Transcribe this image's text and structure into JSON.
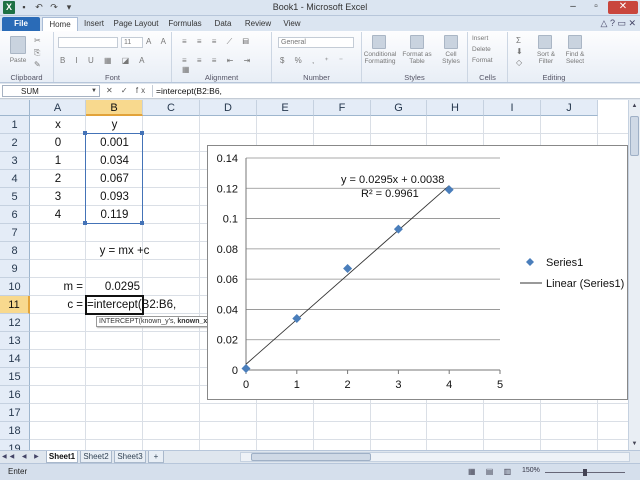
{
  "window": {
    "title": "Book1 - Microsoft Excel"
  },
  "tabs": [
    "File",
    "Home",
    "Insert",
    "Page Layout",
    "Formulas",
    "Data",
    "Review",
    "View"
  ],
  "ribbon": {
    "groups": [
      "Clipboard",
      "Font",
      "Alignment",
      "Number",
      "Styles",
      "Cells",
      "Editing"
    ],
    "paste_label": "Paste",
    "font_size": "11",
    "number_format": "General",
    "styles_buttons": [
      "Conditional Formatting",
      "Format as Table",
      "Cell Styles"
    ],
    "cells_buttons": [
      "Insert",
      "Delete",
      "Format"
    ],
    "editing_buttons": [
      "Sort & Filter",
      "Find & Select"
    ]
  },
  "formula_bar": {
    "name_box": "SUM",
    "formula": "=intercept(B2:B6,"
  },
  "columns": [
    "A",
    "B",
    "C",
    "D",
    "E",
    "F",
    "G",
    "H",
    "I",
    "J"
  ],
  "rows": [
    "1",
    "2",
    "3",
    "4",
    "5",
    "6",
    "7",
    "8",
    "9",
    "10",
    "11",
    "12",
    "13",
    "14",
    "15",
    "16",
    "17",
    "18",
    "19"
  ],
  "cells": {
    "A1": "x",
    "B1": "y",
    "A2": "0",
    "B2": "0.001",
    "A3": "1",
    "B3": "0.034",
    "A4": "2",
    "B4": "0.067",
    "A5": "3",
    "B5": "0.093",
    "A6": "4",
    "B6": "0.119",
    "B8": "y = mx +c",
    "A10": "m =",
    "B10": "0.0295",
    "A11": "c =",
    "B11": "=intercept(B2:B6,"
  },
  "tooltip": {
    "text": "INTERCEPT(known_y's, ",
    "bold": "known_x's",
    "end": ")"
  },
  "chart_data": {
    "type": "scatter",
    "series": [
      {
        "name": "Series1",
        "x": [
          0,
          1,
          2,
          3,
          4
        ],
        "y": [
          0.001,
          0.034,
          0.067,
          0.093,
          0.119
        ]
      }
    ],
    "trendline": {
      "name": "Linear (Series1)",
      "slope": 0.0295,
      "intercept": 0.0038
    },
    "equation_label": "y = 0.0295x + 0.0038",
    "r2_label": "R² = 0.9961",
    "xlim": [
      0,
      5
    ],
    "ylim": [
      0,
      0.14
    ],
    "xticks": [
      "0",
      "1",
      "2",
      "3",
      "4",
      "5"
    ],
    "yticks": [
      "0",
      "0.02",
      "0.04",
      "0.06",
      "0.08",
      "0.1",
      "0.12",
      "0.14"
    ],
    "grid": true,
    "legend": "right",
    "marker_color": "#4a7ebb"
  },
  "sheets": [
    "Sheet1",
    "Sheet2",
    "Sheet3"
  ],
  "status": {
    "mode": "Enter",
    "zoom": "150%"
  }
}
